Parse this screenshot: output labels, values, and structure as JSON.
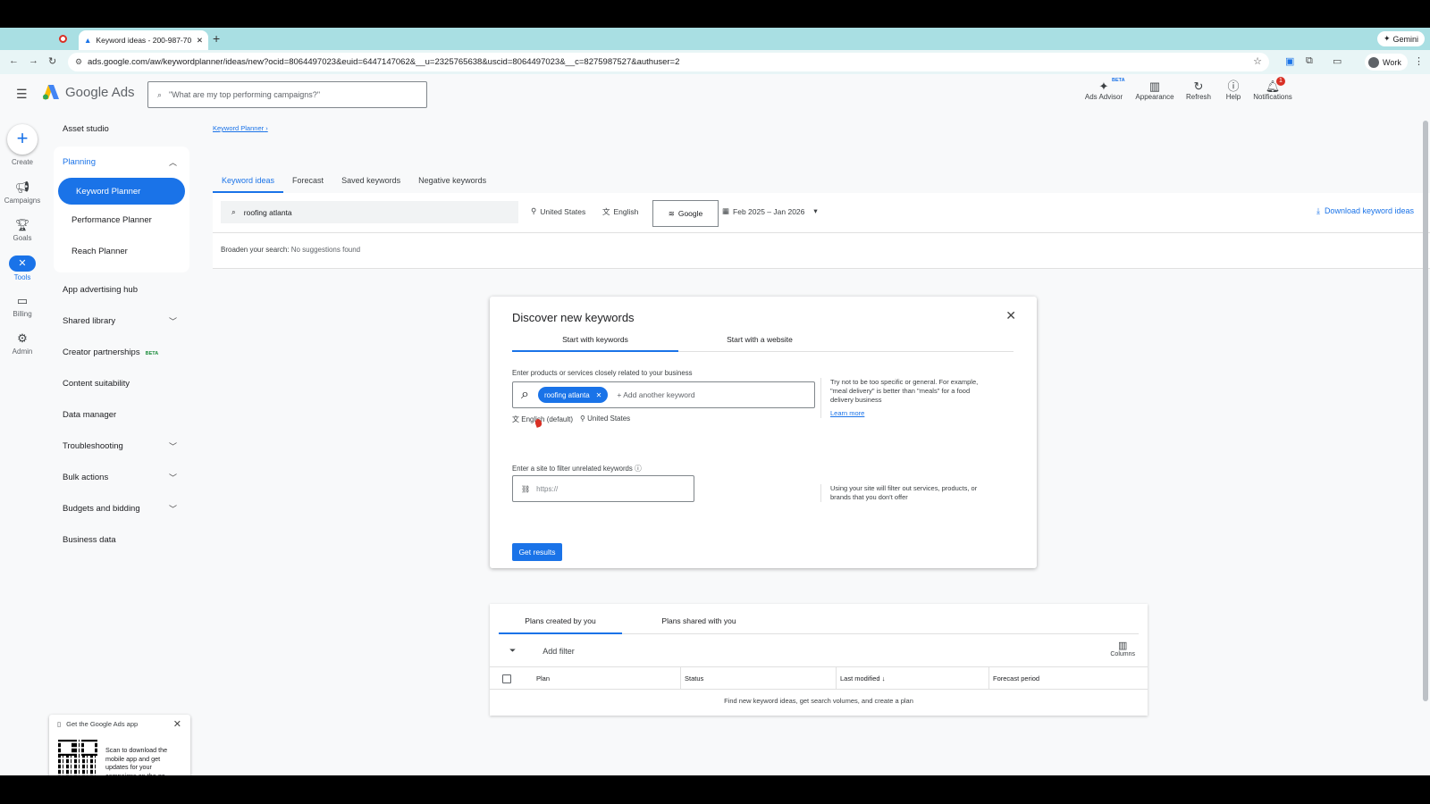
{
  "browser": {
    "tab_title": "Keyword ideas - 200-987-70",
    "url": "ads.google.com/aw/keywordplanner/ideas/new?ocid=8064497023&euid=6447147062&__u=2325765638&uscid=8064497023&__c=8275987527&authuser=2",
    "gemini_label": "Gemini",
    "profile_label": "Work"
  },
  "header": {
    "product_name": "Google Ads",
    "search_placeholder": "\"What are my top performing campaigns?\"",
    "tools": [
      {
        "label": "Ads Advisor",
        "icon": "sparkle-icon",
        "badge": "BETA"
      },
      {
        "label": "Appearance",
        "icon": "appearance-icon"
      },
      {
        "label": "Refresh",
        "icon": "refresh-icon"
      },
      {
        "label": "Help",
        "icon": "help-icon"
      },
      {
        "label": "Notifications",
        "icon": "bell-icon",
        "count": "1"
      }
    ]
  },
  "rail": {
    "items": [
      {
        "label": "Create"
      },
      {
        "label": "Campaigns"
      },
      {
        "label": "Goals"
      },
      {
        "label": "Tools"
      },
      {
        "label": "Billing"
      },
      {
        "label": "Admin"
      }
    ]
  },
  "sidenav": {
    "asset_studio": "Asset studio",
    "planning": "Planning",
    "keyword_planner": "Keyword Planner",
    "performance_planner": "Performance Planner",
    "reach_planner": "Reach Planner",
    "app_hub": "App advertising hub",
    "shared_library": "Shared library",
    "creator_partnerships": "Creator partnerships",
    "creator_beta": "BETA",
    "content_suitability": "Content suitability",
    "data_manager": "Data manager",
    "troubleshooting": "Troubleshooting",
    "bulk_actions": "Bulk actions",
    "budgets_bidding": "Budgets and bidding",
    "business_data": "Business data"
  },
  "main": {
    "breadcrumb": "Keyword Planner",
    "tabs": [
      "Keyword ideas",
      "Forecast",
      "Saved keywords",
      "Negative keywords"
    ],
    "search_value": "roofing atlanta",
    "location": "United States",
    "language": "English",
    "network": "Google",
    "date_range": "Feb 2025 – Jan 2026",
    "download_label": "Download keyword ideas",
    "broaden_label": "Broaden your search:",
    "broaden_value": "No suggestions found"
  },
  "dialog": {
    "title": "Discover new keywords",
    "tab_keywords": "Start with keywords",
    "tab_website": "Start with a website",
    "kw_label": "Enter products or services closely related to your business",
    "chip": "roofing atlanta",
    "add_placeholder": "+ Add another keyword",
    "language": "English (default)",
    "location": "United States",
    "hint": "Try not to be too specific or general. For example, \"meal delivery\" is better than \"meals\" for a food delivery business",
    "learn_more": "Learn more",
    "site_label": "Enter a site to filter unrelated keywords",
    "site_placeholder": "https://",
    "site_hint": "Using your site will filter out services, products, or brands that you don't offer",
    "get_results": "Get results"
  },
  "plans": {
    "tab_created": "Plans created by you",
    "tab_shared": "Plans shared with you",
    "add_filter": "Add filter",
    "columns": "Columns",
    "headers": [
      "Plan",
      "Status",
      "Last modified",
      "Forecast period"
    ],
    "empty": "Find new keyword ideas, get search volumes, and create a plan"
  },
  "promo": {
    "title": "Get the Google Ads app",
    "text": "Scan to download the mobile app and get updates for your campaigns on the go"
  },
  "colors": {
    "accent": "#1a73e8",
    "tabstrip": "#a9dfe3",
    "alert": "#d93025"
  }
}
